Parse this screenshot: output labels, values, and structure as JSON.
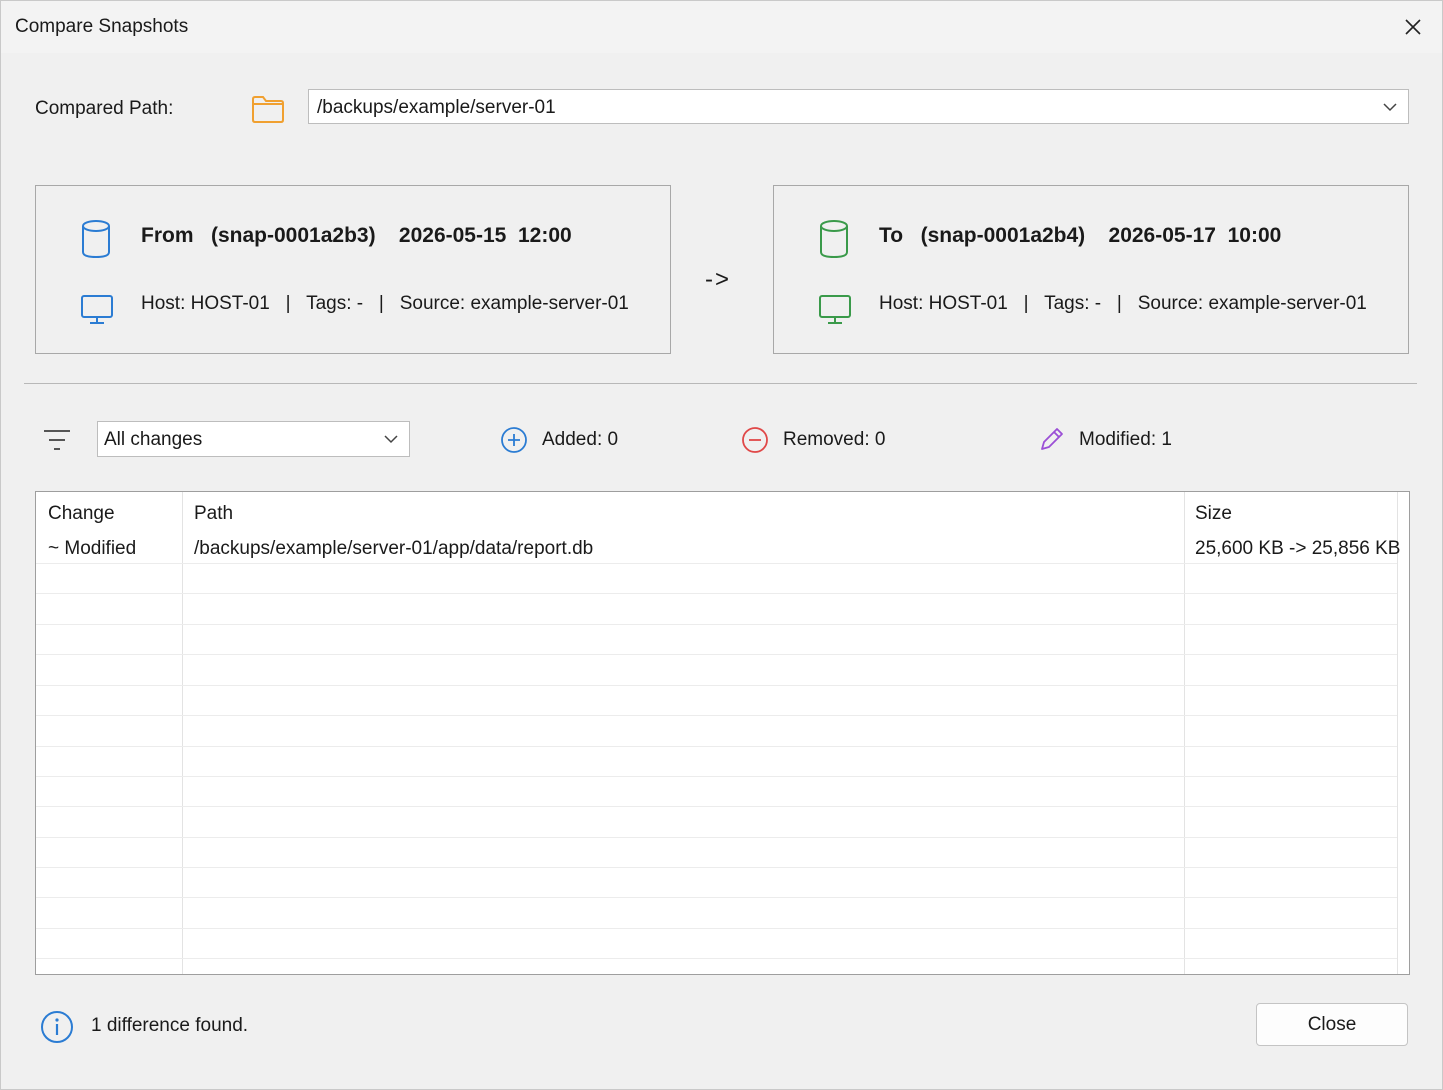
{
  "window": {
    "title": "Compare Snapshots"
  },
  "compared_path": {
    "label": "Compared Path:",
    "value": "/backups/example/server-01"
  },
  "from": {
    "heading": "From   (snap-0001a2b3)    2026-05-15  12:00",
    "meta": "Host: HOST-01   |   Tags: -   |   Source: example-server-01",
    "icon_color": "#2b7cd3"
  },
  "arrow": "->",
  "to": {
    "heading": "To   (snap-0001a2b4)    2026-05-17  10:00",
    "meta": "Host: HOST-01   |   Tags: -   |   Source: example-server-01",
    "icon_color": "#3a9a4a"
  },
  "filter": {
    "selected": "All changes"
  },
  "stats": {
    "added": "Added: 0",
    "removed": "Removed: 0",
    "modified": "Modified: 1"
  },
  "table": {
    "columns": {
      "change": "Change",
      "path": "Path",
      "size": "Size"
    },
    "rows": [
      {
        "change": "~ Modified",
        "path": "/backups/example/server-01/app/data/report.db",
        "size": "25,600 KB -> 25,856 KB"
      }
    ]
  },
  "status": {
    "text": "1 difference found."
  },
  "buttons": {
    "close": "Close"
  },
  "colors": {
    "folder": "#f0a030",
    "added": "#2b7cd3",
    "removed": "#e04848",
    "modified": "#9b4fd6",
    "info": "#2b7cd3"
  }
}
